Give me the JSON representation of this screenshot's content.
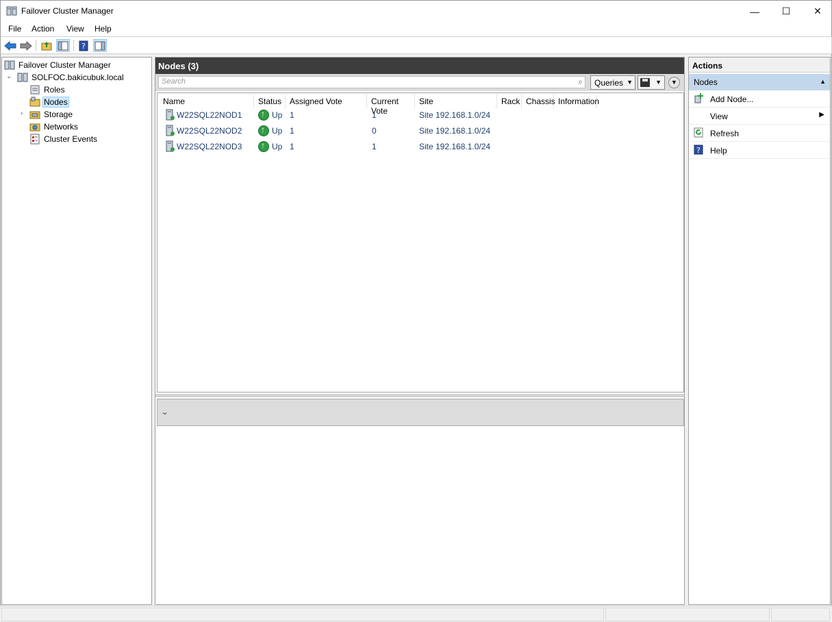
{
  "window": {
    "title": "Failover Cluster Manager",
    "minimize_glyph": "—",
    "maximize_glyph": "☐",
    "close_glyph": "✕"
  },
  "menu": [
    "File",
    "Action",
    "View",
    "Help"
  ],
  "toolbar": {
    "icons": [
      "back-arrow-icon",
      "forward-arrow-icon",
      "up-folder-icon",
      "show-hide-tree-icon",
      "help-icon",
      "show-hide-action-pane-icon"
    ]
  },
  "tree": {
    "root": "Failover Cluster Manager",
    "cluster": "SOLFOC.bakicubuk.local",
    "items": [
      "Roles",
      "Nodes",
      "Storage",
      "Networks",
      "Cluster Events"
    ],
    "selected": "Nodes"
  },
  "center": {
    "header": "Nodes (3)",
    "search_placeholder": "Search",
    "queries_label": "Queries",
    "columns": [
      "Name",
      "Status",
      "Assigned Vote",
      "Current Vote",
      "Site",
      "Rack",
      "Chassis",
      "Information"
    ],
    "rows": [
      {
        "name": "W22SQL22NOD1",
        "status": "Up",
        "assigned_vote": "1",
        "current_vote": "1",
        "site": "Site 192.168.1.0/24"
      },
      {
        "name": "W22SQL22NOD2",
        "status": "Up",
        "assigned_vote": "1",
        "current_vote": "0",
        "site": "Site 192.168.1.0/24"
      },
      {
        "name": "W22SQL22NOD3",
        "status": "Up",
        "assigned_vote": "1",
        "current_vote": "1",
        "site": "Site 192.168.1.0/24"
      }
    ]
  },
  "actions": {
    "header": "Actions",
    "section": "Nodes",
    "items": [
      "Add Node...",
      "View",
      "Refresh",
      "Help"
    ]
  },
  "colors": {
    "title_header_bg": "#3d3d3d",
    "section_bg": "#c2d7ec",
    "selected_bg": "#cce8ff",
    "status_up": "#2f9e44",
    "row_text": "#1e3d70"
  }
}
